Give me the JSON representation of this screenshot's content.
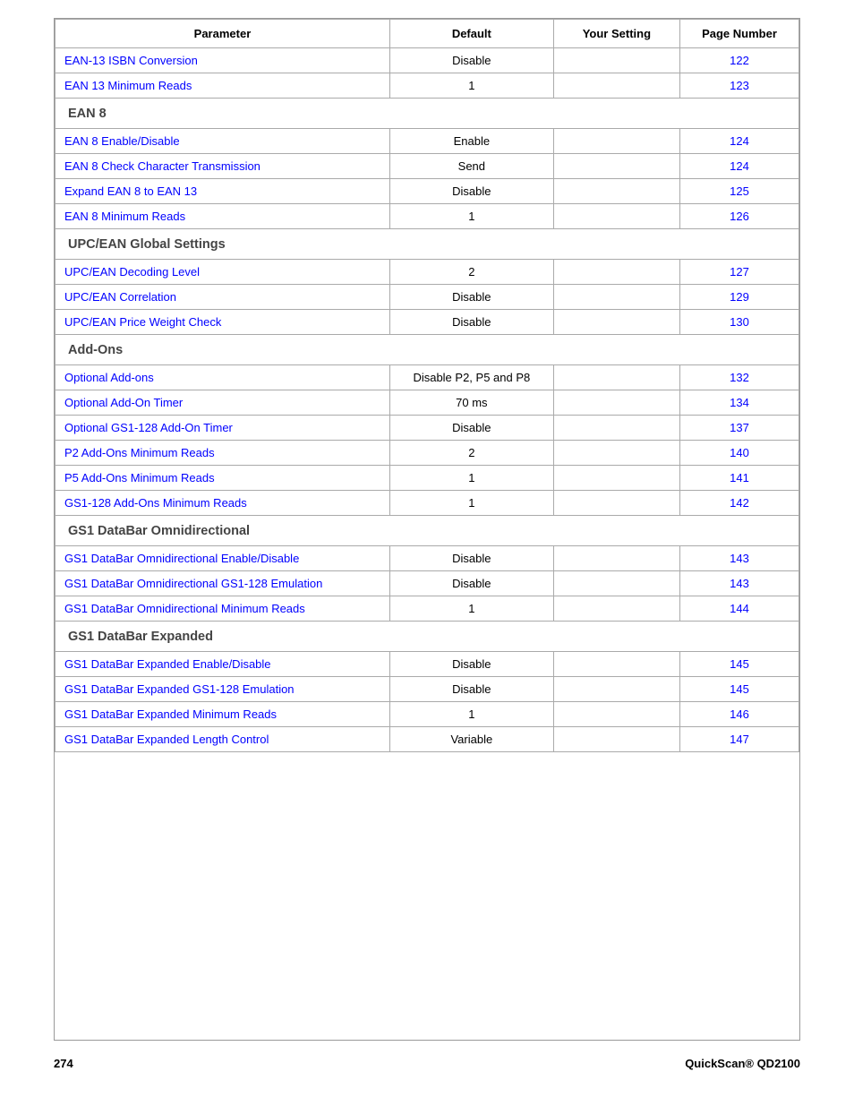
{
  "header": {
    "col1": "Parameter",
    "col2": "Default",
    "col3": "Your Setting",
    "col4": "Page Number"
  },
  "sections": [
    {
      "type": "row",
      "param": "EAN-13 ISBN Conversion",
      "default": "Disable",
      "page": "122"
    },
    {
      "type": "row",
      "param": "EAN 13 Minimum Reads",
      "default": "1",
      "page": "123"
    },
    {
      "type": "section",
      "label": "EAN 8"
    },
    {
      "type": "row",
      "param": "EAN 8 Enable/Disable",
      "default": "Enable",
      "page": "124"
    },
    {
      "type": "row",
      "param": "EAN 8 Check Character Transmission",
      "default": "Send",
      "page": "124"
    },
    {
      "type": "row",
      "param": "Expand EAN 8 to EAN 13",
      "default": "Disable",
      "page": "125"
    },
    {
      "type": "row",
      "param": "EAN 8 Minimum Reads",
      "default": "1",
      "page": "126"
    },
    {
      "type": "section",
      "label": "UPC/EAN Global Settings"
    },
    {
      "type": "row",
      "param": "UPC/EAN Decoding Level",
      "default": "2",
      "page": "127"
    },
    {
      "type": "row",
      "param": "UPC/EAN Correlation",
      "default": "Disable",
      "page": "129"
    },
    {
      "type": "row",
      "param": "UPC/EAN Price Weight Check",
      "default": "Disable",
      "page": "130"
    },
    {
      "type": "section",
      "label": "Add-Ons"
    },
    {
      "type": "row",
      "param": "Optional Add-ons",
      "default": "Disable P2, P5 and P8",
      "page": "132"
    },
    {
      "type": "row",
      "param": "Optional Add-On Timer",
      "default": "70 ms",
      "page": "134"
    },
    {
      "type": "row",
      "param": "Optional GS1-128 Add-On Timer",
      "default": "Disable",
      "page": "137"
    },
    {
      "type": "row",
      "param": "P2 Add-Ons Minimum Reads",
      "default": "2",
      "page": "140"
    },
    {
      "type": "row",
      "param": "P5 Add-Ons Minimum Reads",
      "default": "1",
      "page": "141"
    },
    {
      "type": "row",
      "param": "GS1-128 Add-Ons Minimum Reads",
      "default": "1",
      "page": "142"
    },
    {
      "type": "section",
      "label": "GS1 DataBar Omnidirectional"
    },
    {
      "type": "row",
      "param": "GS1 DataBar Omnidirectional Enable/Disable",
      "default": "Disable",
      "page": "143"
    },
    {
      "type": "row",
      "param": "GS1 DataBar Omnidirectional GS1-128 Emulation",
      "default": "Disable",
      "page": "143"
    },
    {
      "type": "row",
      "param": "GS1 DataBar Omnidirectional Minimum Reads",
      "default": "1",
      "page": "144"
    },
    {
      "type": "section",
      "label": "GS1 DataBar Expanded"
    },
    {
      "type": "row",
      "param": "GS1 DataBar Expanded Enable/Disable",
      "default": "Disable",
      "page": "145"
    },
    {
      "type": "row",
      "param": "GS1 DataBar Expanded GS1-128 Emulation",
      "default": "Disable",
      "page": "145"
    },
    {
      "type": "row",
      "param": "GS1 DataBar Expanded Minimum Reads",
      "default": "1",
      "page": "146"
    },
    {
      "type": "row",
      "param": "GS1 DataBar Expanded Length Control",
      "default": "Variable",
      "page": "147"
    }
  ],
  "footer": {
    "page_number": "274",
    "brand": "QuickScan® QD2100"
  }
}
